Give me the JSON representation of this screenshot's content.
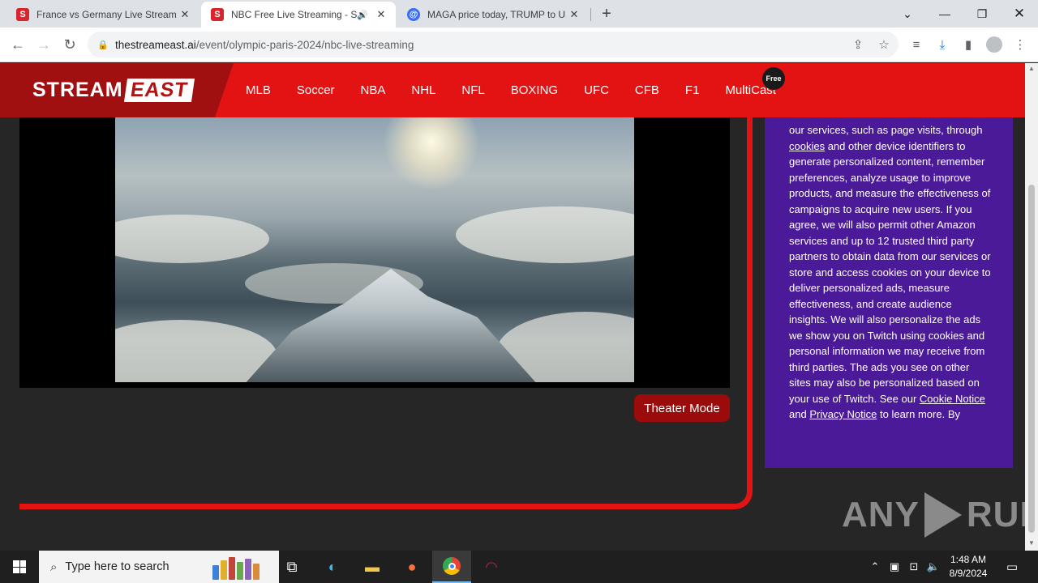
{
  "browser": {
    "tabs": [
      {
        "title": "France vs Germany Live Streamin",
        "favicon": "S",
        "favicon_color": "#d9232d"
      },
      {
        "title": "NBC Free Live Streaming - S",
        "favicon": "S",
        "favicon_color": "#d9232d",
        "audio_icon": "speaker-icon"
      },
      {
        "title": "MAGA price today, TRUMP to US",
        "favicon": "@",
        "favicon_color": "#3b6ef5"
      }
    ],
    "new_tab_label": "+",
    "url_host": "thestreameast.ai",
    "url_path": "/event/olympic-paris-2024/nbc-live-streaming"
  },
  "site": {
    "logo_part1": "STREAM",
    "logo_part2": "EAST",
    "nav": [
      "MLB",
      "Soccer",
      "NBA",
      "NHL",
      "NFL",
      "BOXING",
      "UFC",
      "CFB",
      "F1",
      "MultiCast"
    ],
    "free_badge": "Free",
    "theater_button": "Theater Mode",
    "accent_color": "#e41313"
  },
  "consent": {
    "text_1": "our services, such as page visits, through ",
    "link_cookies": "cookies",
    "text_2": " and other device identifiers to generate personalized content, remember preferences, analyze usage to improve products, and measure the effectiveness of campaigns to acquire new users. If you agree, we will also permit other Amazon services and up to 12 trusted third party partners to obtain data from our services or store and access cookies on your device to deliver personalized ads, measure effectiveness, and create audience insights. We will also personalize the ads we show you on Twitch using cookies and personal information we may receive from third parties. The ads you see on other sites may also be personalized based on your use of Twitch. See our ",
    "link_cookie_notice": "Cookie Notice",
    "text_3": " and ",
    "link_privacy_notice": "Privacy Notice",
    "text_4": " to learn more. By"
  },
  "watermark": {
    "left": "ANY",
    "right": "RUN"
  },
  "taskbar": {
    "search_placeholder": "Type here to search",
    "time": "1:48 AM",
    "date": "8/9/2024"
  }
}
